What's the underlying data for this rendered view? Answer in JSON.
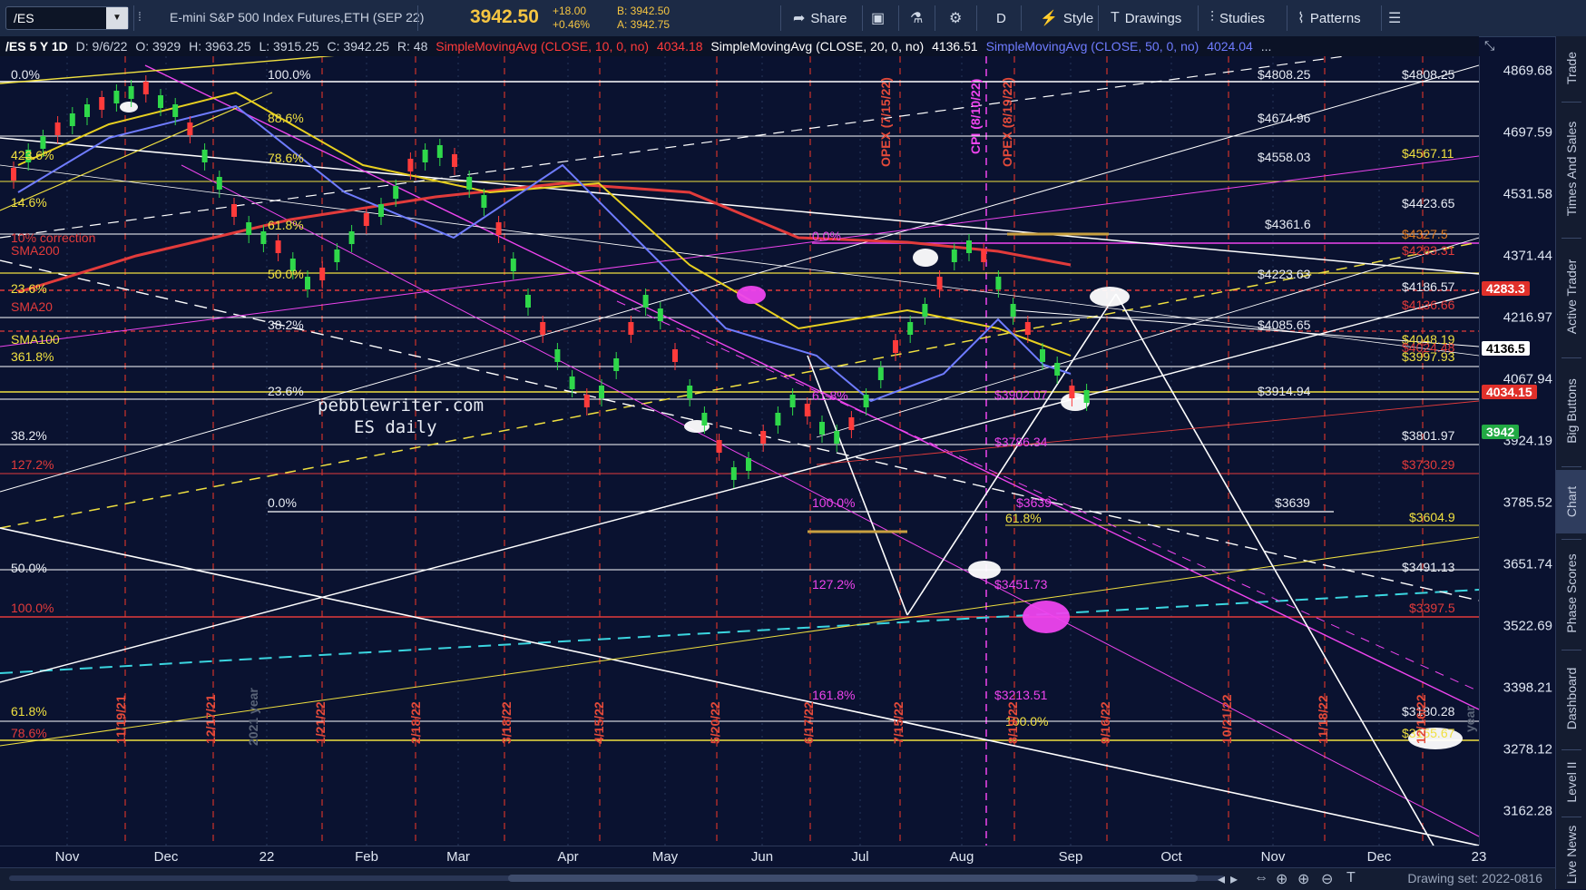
{
  "toolbar": {
    "symbol": "/ES",
    "description": "E-mini S&P 500 Index Futures,ETH (SEP 22)",
    "last": "3942.50",
    "change": "+18.00",
    "change_pct": "+0.46%",
    "bid": "B: 3942.50",
    "ask": "A: 3942.75",
    "share": "Share",
    "aggregation": "D",
    "style": "Style",
    "drawings": "Drawings",
    "studies": "Studies",
    "patterns": "Patterns"
  },
  "study_bar": {
    "header": "/ES 5 Y 1D",
    "date": "D: 9/6/22",
    "open": "O: 3929",
    "high": "H: 3963.25",
    "low": "L: 3915.25",
    "close": "C: 3942.25",
    "r": "R: 48",
    "sma10": "SimpleMovingAvg (CLOSE, 10, 0, no)",
    "sma10_val": "4034.18",
    "sma20": "SimpleMovingAvg (CLOSE, 20, 0, no)",
    "sma20_val": "4136.51",
    "sma50": "SimpleMovingAvg (CLOSE, 50, 0, no)",
    "sma50_val": "4024.04",
    "more": "..."
  },
  "chart_data": {
    "type": "candlestick",
    "symbol": "/ES",
    "interval": "1D",
    "yticks": [
      "4869.68",
      "4697.59",
      "4531.58",
      "4371.44",
      "4216.97",
      "4067.94",
      "3924.19",
      "3785.52",
      "3651.74",
      "3522.69",
      "3398.21",
      "3278.12",
      "3162.28"
    ],
    "ylog": true,
    "xticks": [
      "Nov",
      "Dec",
      "22",
      "Feb",
      "Mar",
      "Apr",
      "May",
      "Jun",
      "Jul",
      "Aug",
      "Sep",
      "Oct",
      "Nov",
      "Dec",
      "23"
    ],
    "price_tags": [
      {
        "label": "4283.3",
        "bg": "#e0302a",
        "fg": "#ffffff"
      },
      {
        "label": "4136.5",
        "bg": "#ffffff",
        "fg": "#000000"
      },
      {
        "label": "4034.15",
        "bg": "#e0302a",
        "fg": "#ffffff"
      },
      {
        "label": "3942",
        "bg": "#22aa44",
        "fg": "#ffffff"
      }
    ],
    "annotations_left": [
      "0.0%",
      "42̶3̶.6%",
      "14.6%",
      "10% correction",
      "SMA200",
      "23.6%",
      "SMA20",
      "SMA100",
      "361.8%",
      "38.2%",
      "127.2%",
      "50.0%",
      "100.0%",
      "61.8%",
      "78.6%"
    ],
    "fib_labels": [
      "100.0%",
      "88.6%",
      "78.6%",
      "61.8%",
      "50.0%",
      "38.2%",
      "23.6%",
      "0.0%"
    ],
    "right_levels": [
      "$4808.25",
      "$4674.96",
      "$4558.03",
      "$4567.11",
      "$4423.65",
      "$4361.6",
      "$4327.5",
      "$4283.31",
      "$4223.63",
      "$4186.57",
      "$4136.66",
      "$4085.65",
      "$4048.19",
      "$4024.48",
      "$3997.93",
      "$3914.94",
      "$3801.97",
      "$3730.29",
      "$3639",
      "$3604.9",
      "$3491.13",
      "$3397.5",
      "$3180.28",
      "$3155.67"
    ],
    "mid_levels": [
      "$3902.07",
      "$3786.34",
      "$3639",
      "$3451.73",
      "$3213.51"
    ],
    "mid_fibs": [
      "0.0%",
      "61.8%",
      "100.0%",
      "127.2%",
      "161.8%",
      "61.8%",
      "100.0%"
    ],
    "timelines": [
      "11/19/21",
      "12/17/21",
      "1/21/22",
      "2/18/22",
      "3/18/22",
      "4/15/22",
      "5/20/22",
      "6/17/22",
      "7/15/22",
      "8/19/22",
      "9/16/22",
      "10/21/22",
      "11/18/22",
      "12/16/22"
    ],
    "opex": [
      "OPEX (7/15/22)",
      "CPI (8/10/22)",
      "OPEX (8/19/22)"
    ],
    "watermark": [
      "pebblewriter.com",
      "ES daily"
    ],
    "year_labels": [
      "2021 year",
      "year"
    ]
  },
  "bottom": {
    "drawing_set": "Drawing set: 2022-0816"
  },
  "sidebar": {
    "tabs": [
      "Trade",
      "Times And Sales",
      "Active Trader",
      "Big Buttons",
      "Chart",
      "Phase Scores",
      "Dashboard",
      "Level II",
      "Live News"
    ]
  }
}
